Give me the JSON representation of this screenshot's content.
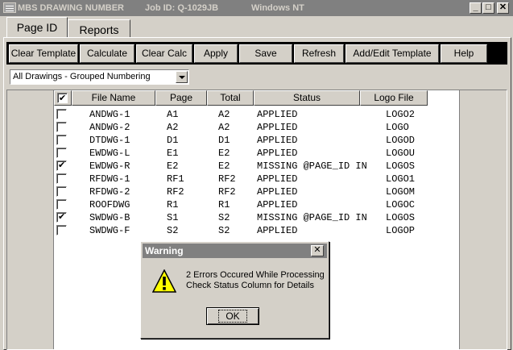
{
  "titlebar": {
    "app_name": "MBS DRAWING NUMBER",
    "job_id": "Job ID: Q-1029JB",
    "os": "Windows NT",
    "min_label": "_",
    "max_label": "□",
    "close_label": "✕"
  },
  "tabs": [
    {
      "label": "Page ID",
      "active": true
    },
    {
      "label": "Reports",
      "active": false
    }
  ],
  "toolbar": {
    "clear_template": "Clear Template",
    "calculate": "Calculate",
    "clear_calc": "Clear Calc",
    "apply": "Apply",
    "save": "Save",
    "refresh": "Refresh",
    "add_edit_template": "Add/Edit Template",
    "help": "Help"
  },
  "filter": {
    "selected": "All Drawings - Grouped Numbering"
  },
  "grid": {
    "header_checked": true,
    "columns": [
      "File Name",
      "Page",
      "Total",
      "Status",
      "Logo File"
    ],
    "rows": [
      {
        "checked": false,
        "file": "ANDWG-1",
        "page": "A1",
        "total": "A2",
        "status": "APPLIED",
        "logo": "LOGO2"
      },
      {
        "checked": false,
        "file": "ANDWG-2",
        "page": "A2",
        "total": "A2",
        "status": "APPLIED",
        "logo": "LOGO"
      },
      {
        "checked": false,
        "file": "DTDWG-1",
        "page": "D1",
        "total": "D1",
        "status": "APPLIED",
        "logo": "LOGOD"
      },
      {
        "checked": false,
        "file": "EWDWG-L",
        "page": "E1",
        "total": "E2",
        "status": "APPLIED",
        "logo": "LOGOU"
      },
      {
        "checked": true,
        "file": "EWDWG-R",
        "page": "E2",
        "total": "E2",
        "status": "MISSING @PAGE_ID IN",
        "logo": "LOGOS"
      },
      {
        "checked": false,
        "file": "RFDWG-1",
        "page": "RF1",
        "total": "RF2",
        "status": "APPLIED",
        "logo": "LOGO1"
      },
      {
        "checked": false,
        "file": "RFDWG-2",
        "page": "RF2",
        "total": "RF2",
        "status": "APPLIED",
        "logo": "LOGOM"
      },
      {
        "checked": false,
        "file": "ROOFDWG",
        "page": "R1",
        "total": "R1",
        "status": "APPLIED",
        "logo": "LOGOC"
      },
      {
        "checked": true,
        "file": "SWDWG-B",
        "page": "S1",
        "total": "S2",
        "status": "MISSING @PAGE_ID IN",
        "logo": "LOGOS"
      },
      {
        "checked": false,
        "file": "SWDWG-F",
        "page": "S2",
        "total": "S2",
        "status": "APPLIED",
        "logo": "LOGOP"
      }
    ]
  },
  "dialog": {
    "title": "Warning",
    "close_label": "✕",
    "line1": "2 Errors Occured While Processing",
    "line2": "Check Status Column for Details",
    "ok_label": "OK",
    "icon": "warning-icon",
    "icon_color": "#ffff00"
  }
}
